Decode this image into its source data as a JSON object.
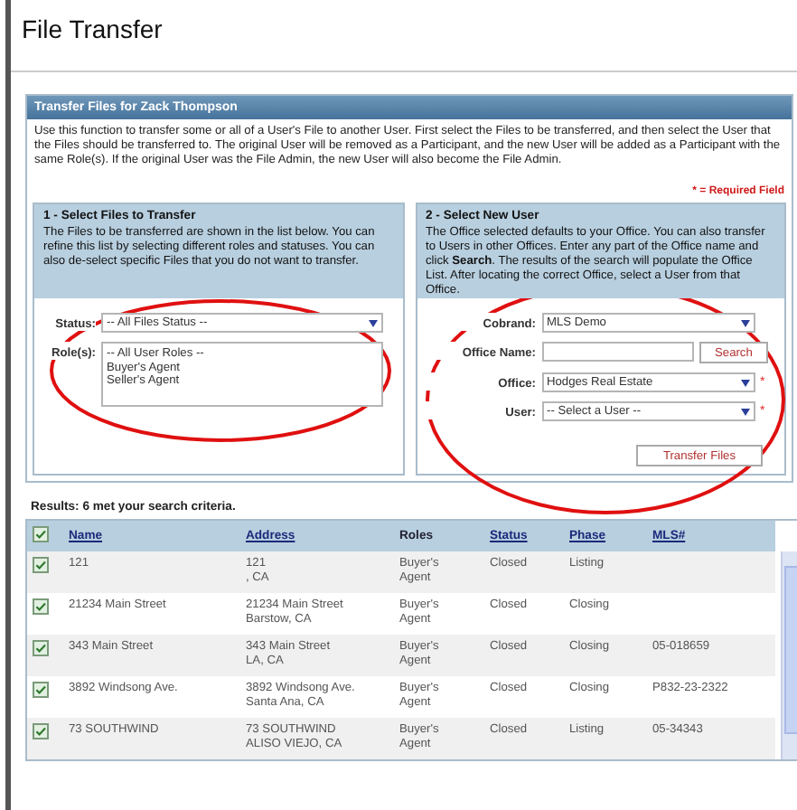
{
  "page_title": "File Transfer",
  "panel": {
    "title": "Transfer Files for Zack Thompson",
    "intro": "Use this function to transfer some or all of a User's File to another User. First select the Files to be transferred, and then select the User that the Files should be transferred to. The original User will be removed as a Participant, and the new User will be added as a Participant with the same Role(s). If the original User was the File Admin, the new User will also become the File Admin.",
    "required_note": "* = Required Field"
  },
  "sections": [
    {
      "title": "1 - Select Files to Transfer",
      "description": "The Files to be transferred are shown in the list below. You can refine this list by selecting different roles and statuses. You can also de-select specific Files that you do not want to transfer.",
      "circled": true,
      "fields": [
        {
          "kind": "select",
          "label": "Status:",
          "value": "-- All Files Status --"
        },
        {
          "kind": "listbox",
          "label": "Role(s):",
          "options": [
            "-- All User Roles --",
            "Buyer's Agent",
            "Seller's Agent"
          ]
        }
      ]
    },
    {
      "title": "2 - Select New User",
      "description": "The Office selected defaults to your Office. You can also transfer to Users in other Offices. Enter any part of the Office name and click **Search**. The results of the search will populate the Office List. After locating the correct Office, select a User from that Office.",
      "circled": true,
      "fields": [
        {
          "kind": "select",
          "label": "Cobrand:",
          "value": "MLS Demo"
        },
        {
          "kind": "search",
          "label": "Office Name:",
          "button": "Search"
        },
        {
          "kind": "select",
          "label": "Office:",
          "value": "Hodges Real Estate",
          "mark": "*"
        },
        {
          "kind": "select",
          "label": "User:",
          "value": "-- Select a User --",
          "mark": "*"
        }
      ],
      "button": "Transfer Files"
    }
  ],
  "results": {
    "summary": "Results: 6 met your search criteria.",
    "select_all": {
      "checked": true
    },
    "columns": [
      {
        "label": "Name",
        "kind": "link"
      },
      {
        "label": "Address",
        "kind": "link"
      },
      {
        "label": "Roles",
        "kind": "text"
      },
      {
        "label": "Status",
        "kind": "link"
      },
      {
        "label": "Phase",
        "kind": "link"
      },
      {
        "label": "MLS#",
        "kind": "link"
      }
    ],
    "rows": [
      {
        "checked": true,
        "name": "121",
        "address": [
          "121",
          ", CA"
        ],
        "roles": "Buyer's Agent",
        "status": "Closed",
        "phase": "Listing",
        "mls": ""
      },
      {
        "checked": true,
        "name": "21234 Main Street",
        "address": [
          "21234 Main Street",
          "Barstow, CA"
        ],
        "roles": "Buyer's Agent",
        "status": "Closed",
        "phase": "Closing",
        "mls": ""
      },
      {
        "checked": true,
        "name": "343 Main Street",
        "address": [
          "343 Main Street",
          "LA, CA"
        ],
        "roles": "Buyer's Agent",
        "status": "Closed",
        "phase": "Closing",
        "mls": "05-018659"
      },
      {
        "checked": true,
        "name": "3892 Windsong Ave.",
        "address": [
          "3892 Windsong Ave.",
          "Santa Ana, CA"
        ],
        "roles": "Buyer's Agent",
        "status": "Closed",
        "phase": "Closing",
        "mls": "P832-23-2322"
      },
      {
        "checked": true,
        "name": "73 SOUTHWIND",
        "address": [
          "73 SOUTHWIND",
          "ALISO VIEJO, CA"
        ],
        "roles": "Buyer's Agent",
        "status": "Closed",
        "phase": "Listing",
        "mls": "05-34343"
      }
    ]
  }
}
